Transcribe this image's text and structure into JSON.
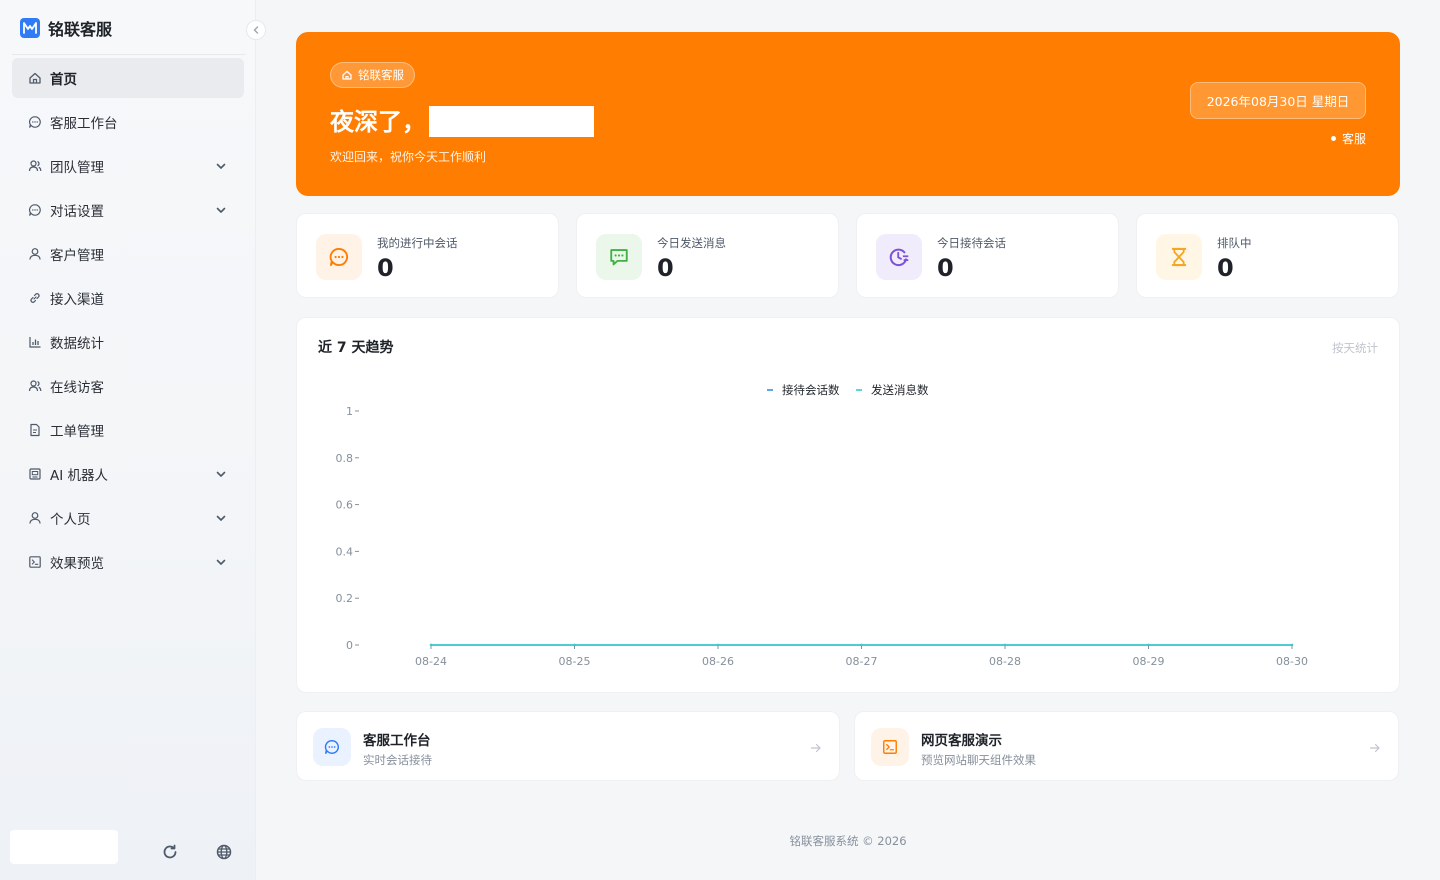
{
  "app": {
    "name": "铭联客服",
    "footer": "铭联客服系统 © 2026"
  },
  "sidebar": {
    "items": [
      {
        "label": "首页",
        "icon": "home-icon",
        "active": true,
        "expandable": false
      },
      {
        "label": "客服工作台",
        "icon": "chat-bubble-icon",
        "active": false,
        "expandable": false
      },
      {
        "label": "团队管理",
        "icon": "team-icon",
        "active": false,
        "expandable": true
      },
      {
        "label": "对话设置",
        "icon": "chat-bubble-icon",
        "active": false,
        "expandable": true
      },
      {
        "label": "客户管理",
        "icon": "user-icon",
        "active": false,
        "expandable": false
      },
      {
        "label": "接入渠道",
        "icon": "link-icon",
        "active": false,
        "expandable": false
      },
      {
        "label": "数据统计",
        "icon": "bar-chart-icon",
        "active": false,
        "expandable": false
      },
      {
        "label": "在线访客",
        "icon": "team-icon",
        "active": false,
        "expandable": false
      },
      {
        "label": "工单管理",
        "icon": "document-icon",
        "active": false,
        "expandable": false
      },
      {
        "label": "AI 机器人",
        "icon": "robot-icon",
        "active": false,
        "expandable": true
      },
      {
        "label": "个人页",
        "icon": "user-icon",
        "active": false,
        "expandable": true
      },
      {
        "label": "效果预览",
        "icon": "terminal-icon",
        "active": false,
        "expandable": true
      }
    ]
  },
  "hero": {
    "tag": "铭联客服",
    "greeting": "夜深了，",
    "subtitle": "欢迎回来，祝你今天工作顺利",
    "date": "2026年08月30日 星期日",
    "role": "客服",
    "bg_color": "#ff7d00"
  },
  "stats": [
    {
      "label": "我的进行中会话",
      "value": "0",
      "icon": "chat-bubble-icon",
      "color": "#ff7d00",
      "bg": "#fff3e8"
    },
    {
      "label": "今日发送消息",
      "value": "0",
      "icon": "message-icon",
      "color": "#43b043",
      "bg": "#ebf7ea"
    },
    {
      "label": "今日接待会话",
      "value": "0",
      "icon": "clock-list-icon",
      "color": "#7b52d8",
      "bg": "#f1ecfb"
    },
    {
      "label": "排队中",
      "value": "0",
      "icon": "hourglass-icon",
      "color": "#f5a623",
      "bg": "#fff6e6"
    }
  ],
  "trend": {
    "title": "近 7 天趋势",
    "hint": "按天统计"
  },
  "chart_data": {
    "type": "line",
    "title": "近 7 天趋势",
    "categories": [
      "08-24",
      "08-25",
      "08-26",
      "08-27",
      "08-28",
      "08-29",
      "08-30"
    ],
    "series": [
      {
        "name": "接待会话数",
        "values": [
          0,
          0,
          0,
          0,
          0,
          0,
          0
        ],
        "color": "#3a8ee6"
      },
      {
        "name": "发送消息数",
        "values": [
          0,
          0,
          0,
          0,
          0,
          0,
          0
        ],
        "color": "#36cbcb"
      }
    ],
    "yticks": [
      "0",
      "0.2",
      "0.4",
      "0.6",
      "0.8",
      "1"
    ],
    "ylim": [
      0,
      1
    ],
    "legend": "top-center",
    "grid": false
  },
  "quick_links": [
    {
      "title": "客服工作台",
      "subtitle": "实时会话接待",
      "icon": "chat-bubble-icon",
      "color": "#2f7cf6",
      "bg": "#eaf2ff"
    },
    {
      "title": "网页客服演示",
      "subtitle": "预览网站聊天组件效果",
      "icon": "terminal-icon",
      "color": "#ff7d00",
      "bg": "#fff3e8"
    }
  ]
}
